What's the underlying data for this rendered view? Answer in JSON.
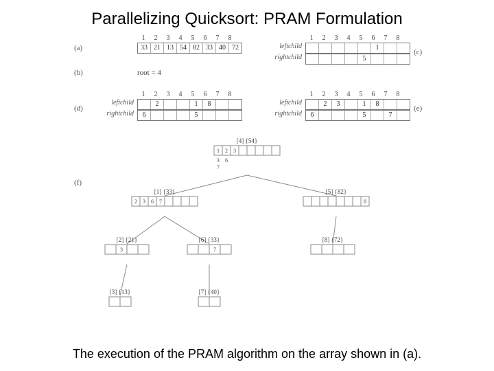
{
  "title": "Parallelizing Quicksort: PRAM Formulation",
  "caption": "The execution of the PRAM algorithm on the array shown in (a).",
  "labels": {
    "a": "(a)",
    "b": "(b)",
    "c": "(c)",
    "d": "(d)",
    "e": "(e)",
    "f": "(f)"
  },
  "root_text": "root = 4",
  "indices": [
    "1",
    "2",
    "3",
    "4",
    "5",
    "6",
    "7",
    "8"
  ],
  "panel_a": {
    "values": [
      "33",
      "21",
      "13",
      "54",
      "82",
      "33",
      "40",
      "72"
    ]
  },
  "row_labels": {
    "left": "leftchild",
    "right": "rightchild"
  },
  "panel_c": {
    "left": [
      "",
      "",
      "",
      "",
      "",
      "1",
      "",
      ""
    ],
    "right": [
      "",
      "",
      "",
      "",
      "5",
      "",
      "",
      ""
    ]
  },
  "panel_d": {
    "left": [
      "",
      "2",
      "",
      "",
      "1",
      "8",
      "",
      ""
    ],
    "right": [
      "6",
      "",
      "",
      "",
      "5",
      "",
      "",
      ""
    ]
  },
  "panel_e": {
    "left": [
      "",
      "2",
      "3",
      "",
      "1",
      "8",
      "",
      ""
    ],
    "right": [
      "6",
      "",
      "",
      "",
      "5",
      "",
      "7",
      ""
    ]
  },
  "tree": {
    "n1": {
      "label": "[4] {54}",
      "cells": [
        "1",
        "2",
        "3",
        "",
        "",
        "",
        "",
        ""
      ],
      "below": [
        "3",
        "6",
        "",
        "",
        "",
        "",
        "",
        ""
      ],
      "below2": [
        "7",
        "",
        "",
        "",
        "",
        "",
        "",
        ""
      ]
    },
    "n2": {
      "label": "[1] {33}",
      "cells": [
        "2",
        "3",
        "6",
        "7",
        "",
        "",
        "",
        ""
      ]
    },
    "n3": {
      "label": "[5] {82}",
      "cells": [
        "",
        "",
        "",
        "",
        "",
        "",
        "",
        "8"
      ]
    },
    "n4": {
      "label": "[2] {21}",
      "cells": [
        "",
        "",
        "3",
        "",
        "",
        "",
        "",
        ""
      ]
    },
    "n5": {
      "label": "[6] {33}",
      "cells": [
        "",
        "",
        "",
        "",
        "",
        "",
        "7",
        ""
      ]
    },
    "n6": {
      "label": "[8] {72}",
      "cells": [
        "",
        "",
        "",
        "",
        "",
        "",
        "",
        ""
      ]
    },
    "n7": {
      "label": "[3] {13}"
    },
    "n8": {
      "label": "[7] {40}"
    }
  }
}
